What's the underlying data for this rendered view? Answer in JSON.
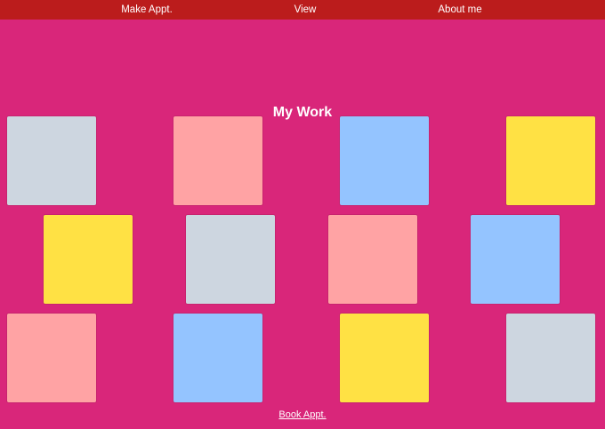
{
  "nav": {
    "items": [
      {
        "label": "Make Appt."
      },
      {
        "label": "View"
      },
      {
        "label": "About me"
      }
    ]
  },
  "page": {
    "title": "My Work"
  },
  "colors": {
    "background": "#d9267a",
    "nav_bar": "#bb1c1c",
    "text": "#ffffff",
    "tile_gray": "#cdd6e0",
    "tile_pink": "#ffa3a4",
    "tile_blue": "#94c4ff",
    "tile_yellow": "#ffe144"
  },
  "gallery": {
    "rows": [
      [
        "tile_gray",
        "tile_pink",
        "tile_blue",
        "tile_yellow"
      ],
      [
        "tile_yellow",
        "tile_gray",
        "tile_pink",
        "tile_blue"
      ],
      [
        "tile_pink",
        "tile_blue",
        "tile_yellow",
        "tile_gray"
      ]
    ]
  },
  "footer": {
    "link_label": "Book Appt."
  }
}
